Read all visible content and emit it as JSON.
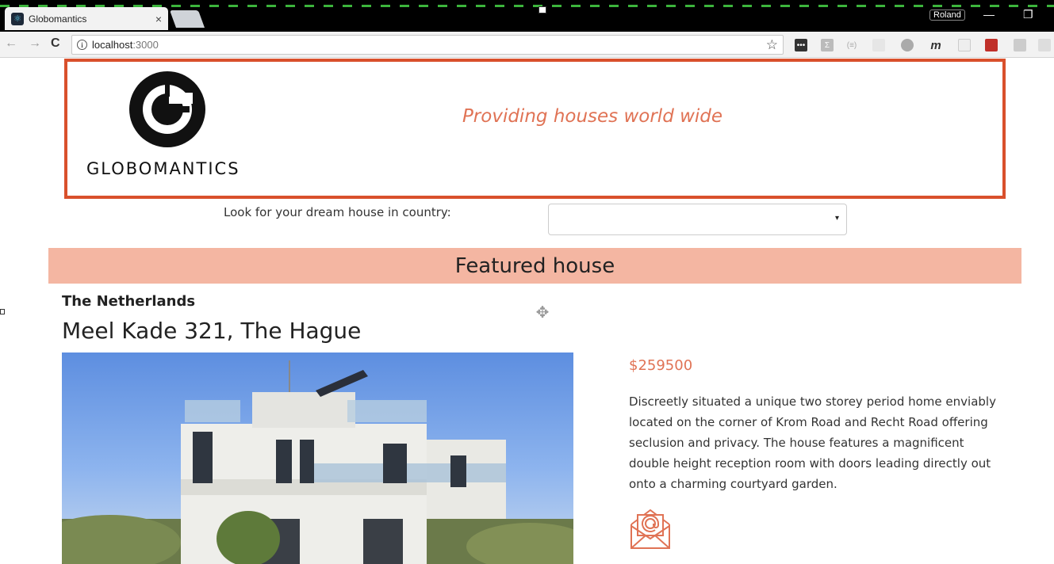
{
  "browser": {
    "tab_title": "Globomantics",
    "tab_close": "×",
    "profile_name": "Roland",
    "minimize": "—",
    "restore": "❐",
    "url_host": "localhost",
    "url_port": ":3000",
    "info_glyph": "i",
    "back_glyph": "←",
    "forward_glyph": "→",
    "reload_glyph": "C",
    "star_glyph": "☆"
  },
  "header": {
    "logo_text": "GLOBOMANTICS",
    "tagline": "Providing houses world wide",
    "border_color": "#d9502c"
  },
  "search": {
    "label": "Look for your dream house in country:",
    "selected_value": "",
    "caret": "▾"
  },
  "featured": {
    "section_title": "Featured house",
    "country": "The Netherlands",
    "address": "Meel Kade 321, The Hague",
    "price": "$259500",
    "description": "Discreetly situated a unique two storey period home enviably located on the corner of Krom Road and Recht Road offering seclusion and privacy. The house features a magnificent double height reception room with doors leading directly out onto a charming courtyard garden.",
    "image": "house-photo",
    "contact_icon": "email-envelope-icon"
  },
  "colors": {
    "accent": "#e07355",
    "featured_bar": "#f4b6a2"
  }
}
